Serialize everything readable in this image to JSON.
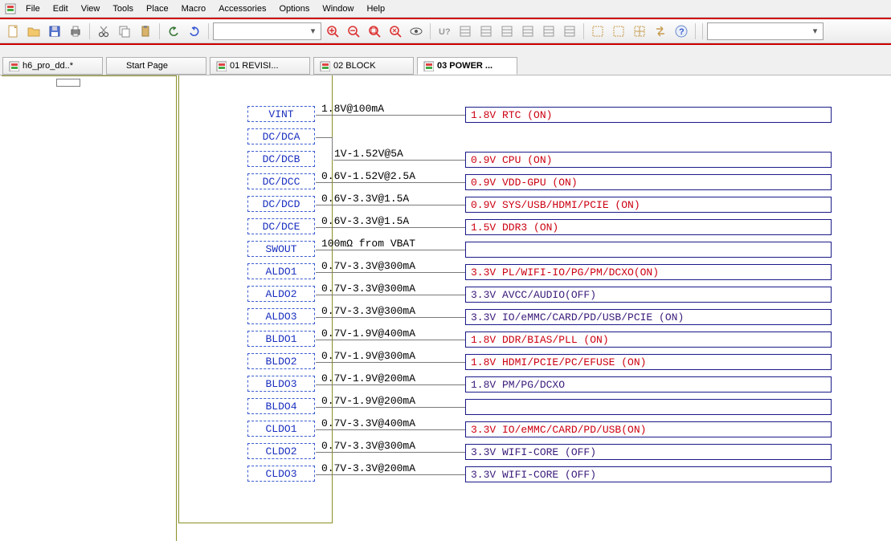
{
  "menu": {
    "items": [
      "File",
      "Edit",
      "View",
      "Tools",
      "Place",
      "Macro",
      "Accessories",
      "Options",
      "Window",
      "Help"
    ]
  },
  "toolbar": {
    "buttons": [
      {
        "name": "new-icon",
        "svg": "doc"
      },
      {
        "name": "open-icon",
        "svg": "folder"
      },
      {
        "name": "save-icon",
        "svg": "disk"
      },
      {
        "name": "print-icon",
        "svg": "printer"
      },
      {
        "name": "cut-icon",
        "svg": "cut"
      },
      {
        "name": "copy-icon",
        "svg": "copy"
      },
      {
        "name": "paste-icon",
        "svg": "paste"
      },
      {
        "name": "undo-icon",
        "svg": "undo"
      },
      {
        "name": "redo-icon",
        "svg": "redo"
      }
    ],
    "rightButtons": [
      {
        "name": "zoom-in-icon",
        "svg": "zoomin"
      },
      {
        "name": "zoom-out-icon",
        "svg": "zoomout"
      },
      {
        "name": "zoom-fit-icon",
        "svg": "zoomfit"
      },
      {
        "name": "zoom-area-icon",
        "svg": "zoomarea"
      },
      {
        "name": "eye-icon",
        "svg": "eye"
      },
      {
        "name": "uquestion-icon",
        "svg": "uq"
      },
      {
        "name": "tool-a-icon",
        "svg": "ga"
      },
      {
        "name": "tool-b-icon",
        "svg": "gb"
      },
      {
        "name": "tool-c-icon",
        "svg": "gc"
      },
      {
        "name": "tool-d-icon",
        "svg": "gd"
      },
      {
        "name": "tool-e-icon",
        "svg": "ge"
      },
      {
        "name": "tool-f-icon",
        "svg": "gf"
      },
      {
        "name": "select-icon",
        "svg": "sel"
      },
      {
        "name": "select-all-icon",
        "svg": "sela"
      },
      {
        "name": "cross-icon",
        "svg": "cross"
      },
      {
        "name": "transfer-icon",
        "svg": "xfer"
      },
      {
        "name": "help-icon",
        "svg": "help"
      }
    ]
  },
  "tabs": [
    {
      "id": "h6",
      "label": "h6_pro_dd..*",
      "active": false,
      "hasIcon": true
    },
    {
      "id": "start",
      "label": "Start Page",
      "active": false,
      "hasIcon": false
    },
    {
      "id": "rev",
      "label": "01 REVISI...",
      "active": false,
      "hasIcon": true
    },
    {
      "id": "block",
      "label": "02 BLOCK",
      "active": false,
      "hasIcon": true
    },
    {
      "id": "power",
      "label": "03 POWER ...",
      "active": true,
      "hasIcon": true
    }
  ],
  "rows": [
    {
      "rail": "VINT",
      "spec": "1.8V@100mA",
      "net": "1.8V RTC (ON)",
      "color": "red"
    },
    {
      "rail": "DC/DCA",
      "spec": "",
      "net": "",
      "color": ""
    },
    {
      "rail": "DC/DCB",
      "spec": "1V-1.52V@5A",
      "net": "0.9V CPU (ON)",
      "color": "red"
    },
    {
      "rail": "DC/DCC",
      "spec": "0.6V-1.52V@2.5A",
      "net": "0.9V VDD-GPU (ON)",
      "color": "red"
    },
    {
      "rail": "DC/DCD",
      "spec": "0.6V-3.3V@1.5A",
      "net": "0.9V SYS/USB/HDMI/PCIE (ON)",
      "color": "red"
    },
    {
      "rail": "DC/DCE",
      "spec": "0.6V-3.3V@1.5A",
      "net": "1.5V DDR3 (ON)",
      "color": "red"
    },
    {
      "rail": "SWOUT",
      "spec": "100mΩ from VBAT",
      "net": "",
      "color": "blank"
    },
    {
      "rail": "ALDO1",
      "spec": "0.7V-3.3V@300mA",
      "net": "3.3V PL/WIFI-IO/PG/PM/DCXO(ON)",
      "color": "red"
    },
    {
      "rail": "ALDO2",
      "spec": "0.7V-3.3V@300mA",
      "net": "3.3V AVCC/AUDIO(OFF)",
      "color": "purple"
    },
    {
      "rail": "ALDO3",
      "spec": "0.7V-3.3V@300mA",
      "net": "3.3V IO/eMMC/CARD/PD/USB/PCIE (ON)",
      "color": "purple"
    },
    {
      "rail": "BLDO1",
      "spec": "0.7V-1.9V@400mA",
      "net": "1.8V DDR/BIAS/PLL (ON)",
      "color": "red"
    },
    {
      "rail": "BLDO2",
      "spec": "0.7V-1.9V@300mA",
      "net": "1.8V HDMI/PCIE/PC/EFUSE (ON)",
      "color": "red"
    },
    {
      "rail": "BLDO3",
      "spec": "0.7V-1.9V@200mA",
      "net": "1.8V PM/PG/DCXO",
      "color": "purple"
    },
    {
      "rail": "BLDO4",
      "spec": "0.7V-1.9V@200mA",
      "net": "",
      "color": "blank"
    },
    {
      "rail": "CLDO1",
      "spec": "0.7V-3.3V@400mA",
      "net": "3.3V IO/eMMC/CARD/PD/USB(ON)",
      "color": "red"
    },
    {
      "rail": "CLDO2",
      "spec": "0.7V-3.3V@300mA",
      "net": "3.3V WIFI-CORE (OFF)",
      "color": "purple"
    },
    {
      "rail": "CLDO3",
      "spec": "0.7V-3.3V@200mA",
      "net": "3.3V WIFI-CORE (OFF)",
      "color": "purple"
    }
  ]
}
